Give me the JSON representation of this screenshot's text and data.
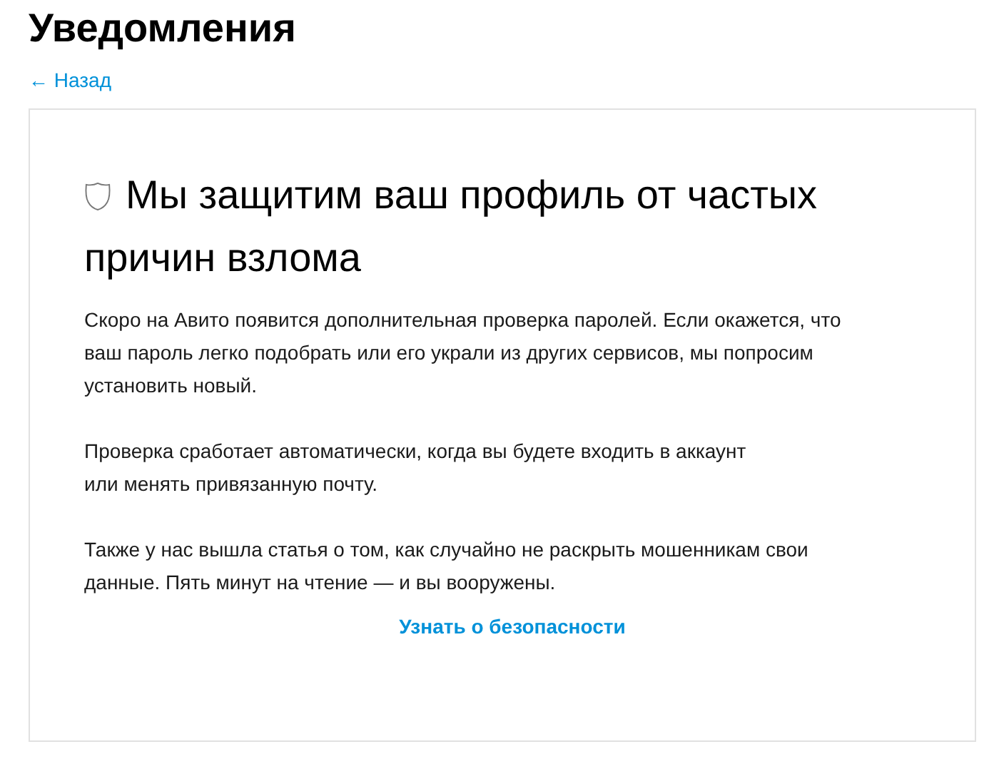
{
  "page": {
    "title": "Уведомления",
    "back_link": "← Назад"
  },
  "card": {
    "title": "Мы защитим ваш профиль от частых причин взлома",
    "paragraphs": [
      {
        "lines": [
          "Скоро на Авито появится дополнительная проверка паролей. Если окажется, что",
          "ваш пароль легко подобрать или его украли из других сервисов, мы попросим",
          "установить новый."
        ]
      },
      {
        "lines": [
          "Проверка сработает автоматически, когда вы будете входить в аккаунт",
          "или менять привязанную почту."
        ]
      },
      {
        "lines": [
          "Также у нас вышла статья о том, как случайно не раскрыть мошенникам свои",
          "данные. Пять минут на чтение — и вы вооружены."
        ]
      }
    ],
    "link": "Узнать о безопасности"
  }
}
